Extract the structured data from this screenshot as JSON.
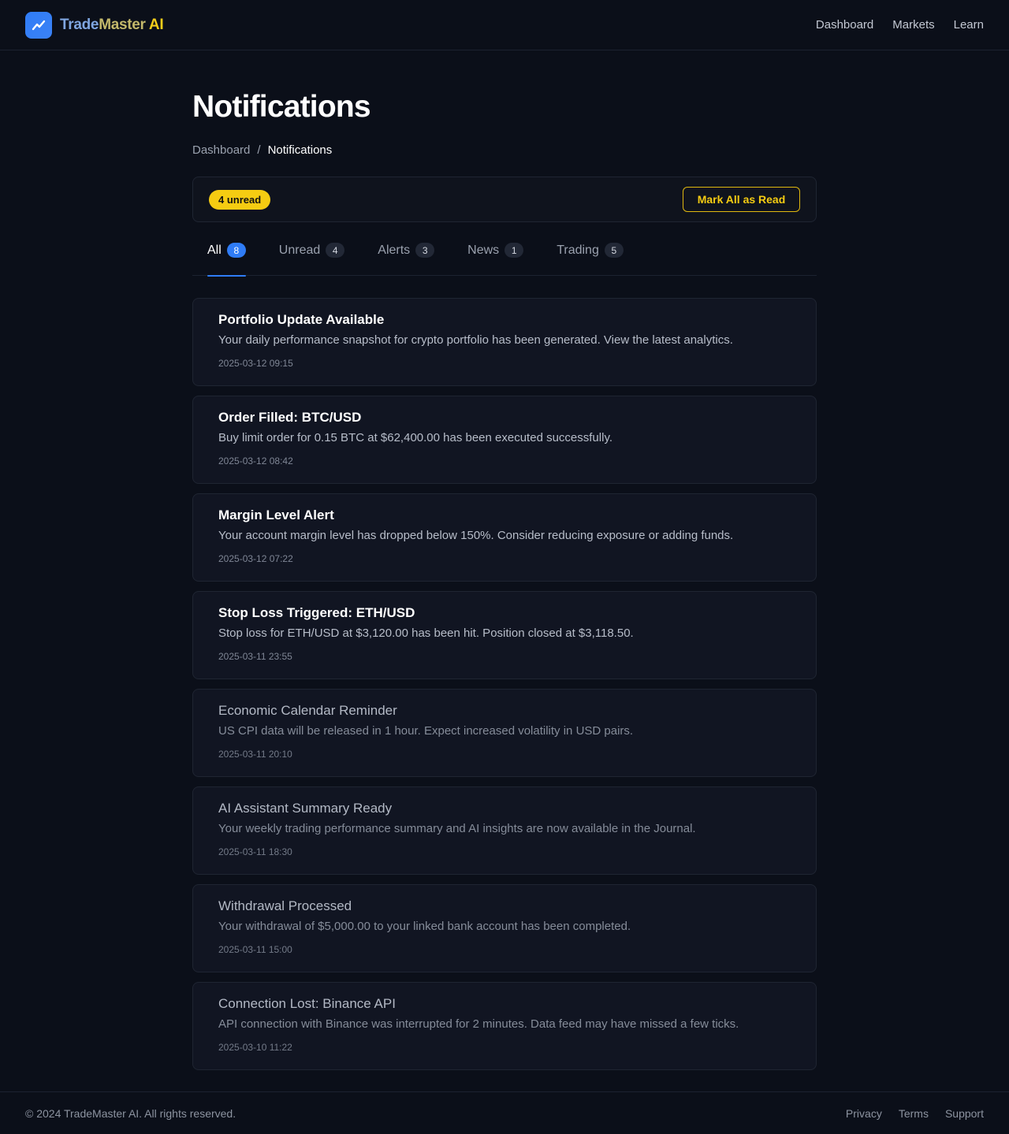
{
  "header": {
    "brand_part1": "Trade",
    "brand_part2": "Master",
    "brand_part3": " AI",
    "logo_icon": "trending-up-icon",
    "nav": [
      "Dashboard",
      "Markets",
      "Learn"
    ]
  },
  "page": {
    "title": "Notifications",
    "breadcrumb": {
      "parent": "Dashboard",
      "separator": "/",
      "current": "Notifications"
    }
  },
  "summary": {
    "unread_label": "4 unread",
    "mark_all_label": "Mark All as Read"
  },
  "tabs": [
    {
      "label": "All",
      "count": "8",
      "active": true
    },
    {
      "label": "Unread",
      "count": "4"
    },
    {
      "label": "Alerts",
      "count": "3"
    },
    {
      "label": "News",
      "count": "1"
    },
    {
      "label": "Trading",
      "count": "5"
    }
  ],
  "notifications": [
    {
      "title": "Portfolio Update Available",
      "body": "Your daily performance snapshot for crypto portfolio has been generated. View the latest analytics.",
      "time": "2025-03-12 09:15",
      "read": false
    },
    {
      "title": "Order Filled: BTC/USD",
      "body": "Buy limit order for 0.15 BTC at $62,400.00 has been executed successfully.",
      "time": "2025-03-12 08:42",
      "read": false
    },
    {
      "title": "Margin Level Alert",
      "body": "Your account margin level has dropped below 150%. Consider reducing exposure or adding funds.",
      "time": "2025-03-12 07:22",
      "read": false
    },
    {
      "title": "Stop Loss Triggered: ETH/USD",
      "body": "Stop loss for ETH/USD at $3,120.00 has been hit. Position closed at $3,118.50.",
      "time": "2025-03-11 23:55",
      "read": false
    },
    {
      "title": "Economic Calendar Reminder",
      "body": "US CPI data will be released in 1 hour. Expect increased volatility in USD pairs.",
      "time": "2025-03-11 20:10",
      "read": true
    },
    {
      "title": "AI Assistant Summary Ready",
      "body": "Your weekly trading performance summary and AI insights are now available in the Journal.",
      "time": "2025-03-11 18:30",
      "read": true
    },
    {
      "title": "Withdrawal Processed",
      "body": "Your withdrawal of $5,000.00 to your linked bank account has been completed.",
      "time": "2025-03-11 15:00",
      "read": true
    },
    {
      "title": "Connection Lost: Binance API",
      "body": "API connection with Binance was interrupted for 2 minutes. Data feed may have missed a few ticks.",
      "time": "2025-03-10 11:22",
      "read": true
    }
  ],
  "footer": {
    "copyright": "© 2024 TradeMaster AI. All rights reserved.",
    "links": [
      "Privacy",
      "Terms",
      "Support"
    ]
  },
  "colors": {
    "background": "#0b0f19",
    "accent_blue": "#2f7cf6",
    "accent_yellow": "#f5cc12",
    "card_bg": "#111522"
  }
}
